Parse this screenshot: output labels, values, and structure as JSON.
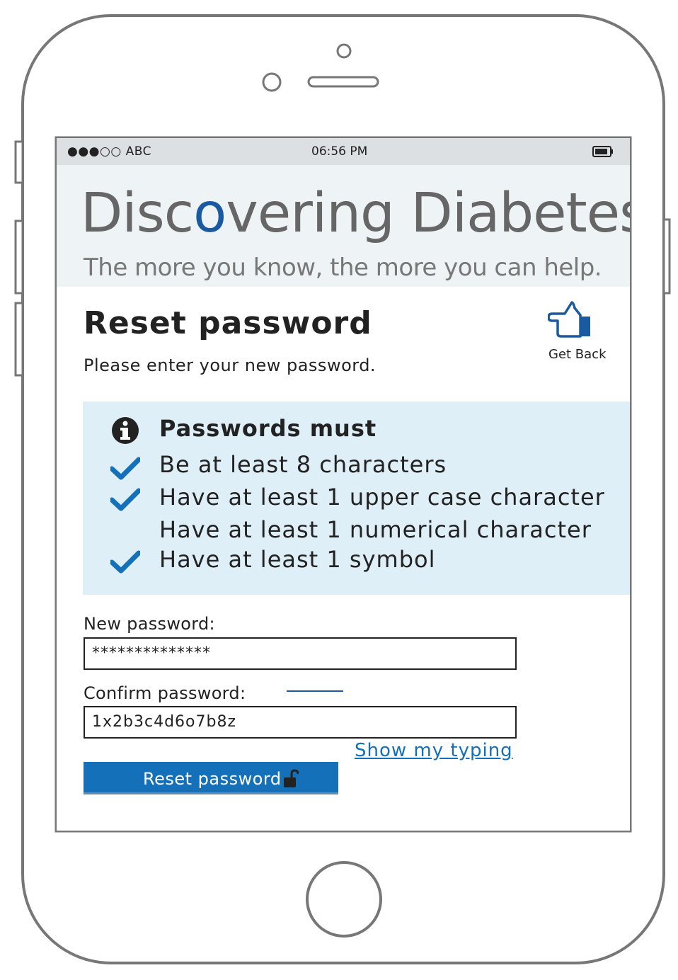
{
  "status_bar": {
    "carrier": "●●●○○ ABC",
    "time": "06:56 PM",
    "battery_icon": "battery-icon"
  },
  "header": {
    "title_pre": "Disc",
    "title_o": "o",
    "title_post": "vering Diabetes",
    "tagline": "The more you know, the more you can help."
  },
  "page": {
    "title": "Reset password",
    "subtitle": "Please enter your new password."
  },
  "get_back": {
    "label": "Get Back",
    "icon": "pointing-hand-icon"
  },
  "rules": {
    "heading": "Passwords must",
    "icon": "info-icon",
    "items": [
      {
        "text": "Be at least 8 characters",
        "met": true
      },
      {
        "text": "Have at least 1 upper case character",
        "met": true
      },
      {
        "text": "Have at least 1 numerical character",
        "met": false
      },
      {
        "text": "Have at least 1 symbol",
        "met": true
      }
    ]
  },
  "form": {
    "new_password_label": "New password:",
    "new_password_value": "**************",
    "confirm_password_label": "Confirm password:",
    "confirm_password_value": "1x2b3c4d6o7b8z",
    "show_typing_link": "Show my typing",
    "submit_label": "Reset password",
    "submit_icon": "unlock-icon"
  },
  "colors": {
    "accent": "#1470b8",
    "rules_background": "#dfeff7",
    "header_background": "#eef3f5",
    "status_bar": "#dde0e3"
  }
}
